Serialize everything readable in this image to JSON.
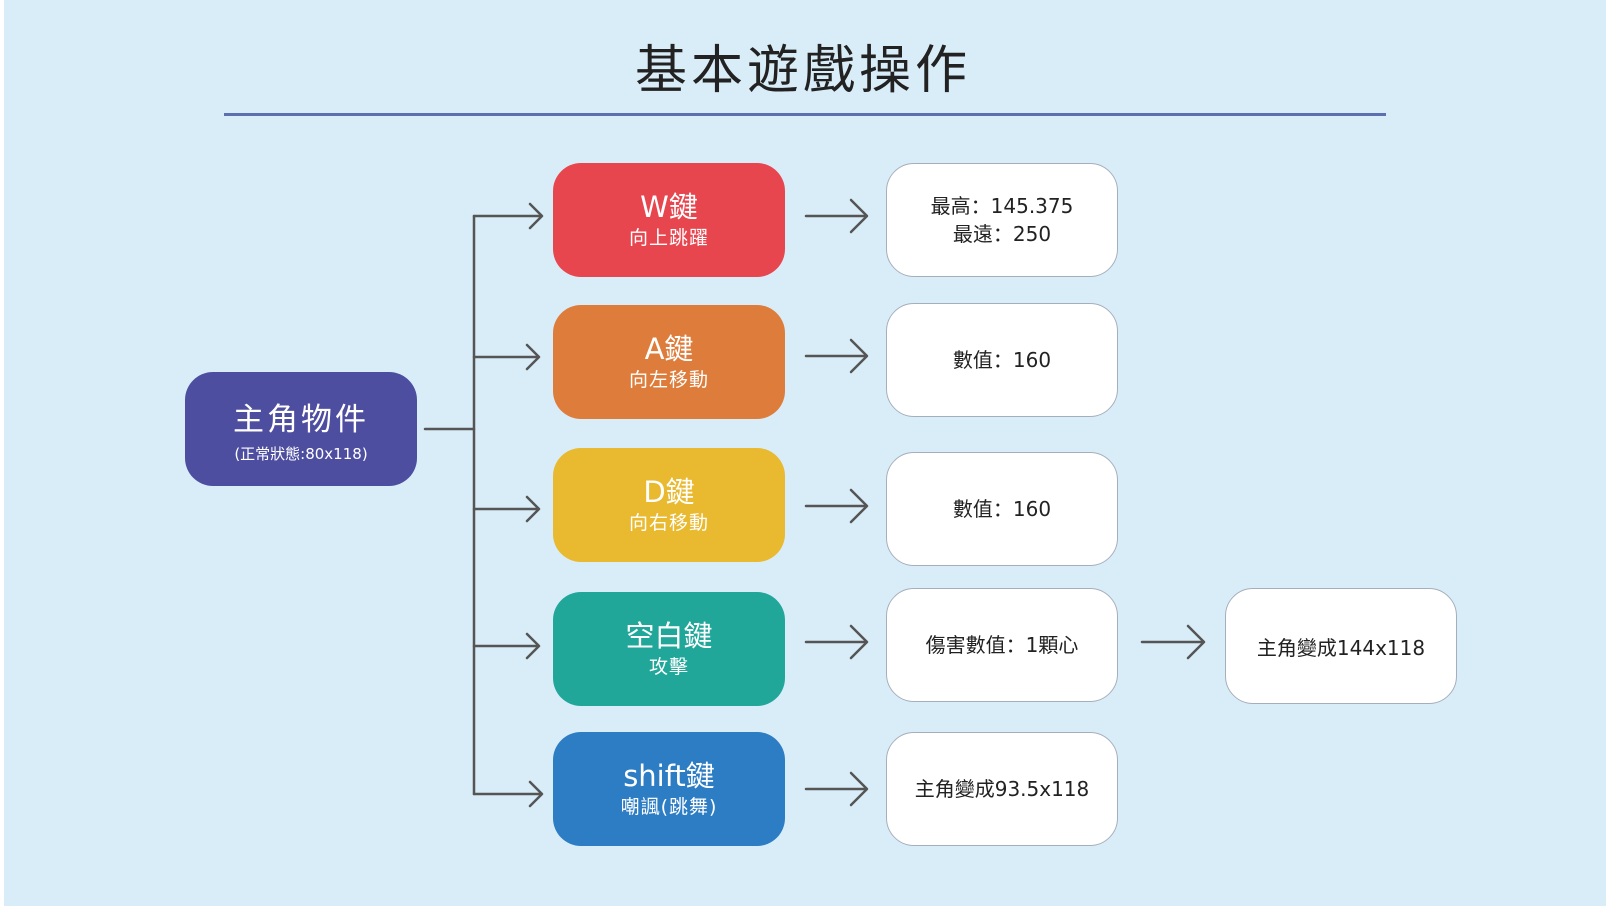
{
  "title": "基本遊戲操作",
  "root": {
    "label": "主角物件",
    "sub": "(正常狀態:80x118)"
  },
  "keys": [
    {
      "label": "W鍵",
      "action": "向上跳躍",
      "color": "#e8464f"
    },
    {
      "label": "A鍵",
      "action": "向左移動",
      "color": "#de7d3b"
    },
    {
      "label": "D鍵",
      "action": "向右移動",
      "color": "#e9b92f"
    },
    {
      "label": "空白鍵",
      "action": "攻擊",
      "color": "#20a79a"
    },
    {
      "label": "shift鍵",
      "action": "嘲諷(跳舞)",
      "color": "#2c7dc4"
    }
  ],
  "results": [
    {
      "line1": "最高：145.375",
      "line2": "最遠：250"
    },
    {
      "line1": "數值：160",
      "line2": ""
    },
    {
      "line1": "數值：160",
      "line2": ""
    },
    {
      "line1": "傷害數值：1顆心",
      "line2": ""
    },
    {
      "line1": "主角變成93.5x118",
      "line2": ""
    }
  ],
  "attack_result": "主角變成144x118",
  "colors": {
    "line": "#555555",
    "arrow": "#555555",
    "title_rule": "#5b6fb1",
    "background": "#d9edf9"
  }
}
